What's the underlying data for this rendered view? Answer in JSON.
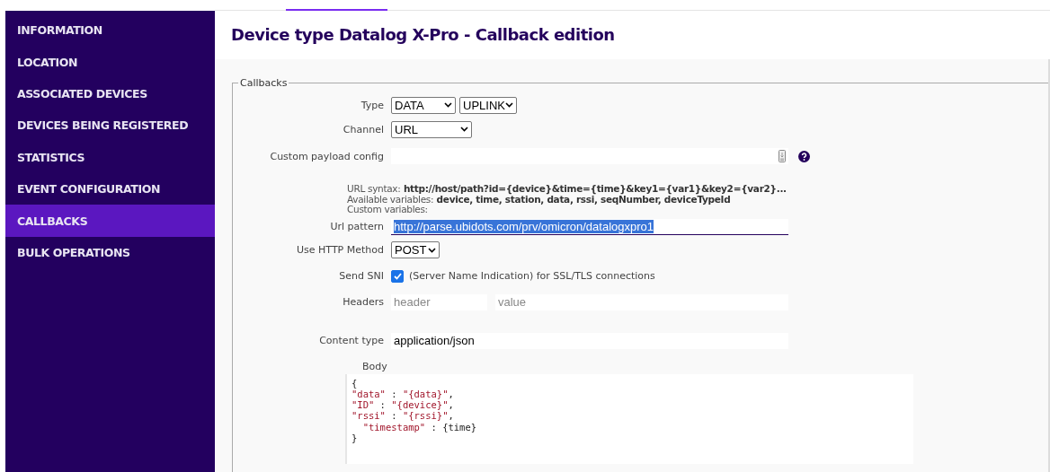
{
  "sidebar": {
    "items": [
      {
        "label": "INFORMATION",
        "selected": false
      },
      {
        "label": "LOCATION",
        "selected": false
      },
      {
        "label": "ASSOCIATED DEVICES",
        "selected": false
      },
      {
        "label": "DEVICES BEING REGISTERED",
        "selected": false
      },
      {
        "label": "STATISTICS",
        "selected": false
      },
      {
        "label": "EVENT CONFIGURATION",
        "selected": false
      },
      {
        "label": "CALLBACKS",
        "selected": true
      },
      {
        "label": "BULK OPERATIONS",
        "selected": false
      }
    ]
  },
  "title": "Device type Datalog X-Pro - Callback edition",
  "fieldset": {
    "legend": "Callbacks",
    "type": {
      "label": "Type",
      "selects": [
        "DATA",
        "UPLINK"
      ]
    },
    "channel": {
      "label": "Channel",
      "select": "URL"
    },
    "custom_payload": {
      "label": "Custom payload config"
    },
    "help": [
      {
        "label": "URL syntax:",
        "value": "http://host/path?id={device}&time={time}&key1={var1}&key2={var2}..."
      },
      {
        "label": "Available variables:",
        "value": "device, time, station, data, rssi, seqNumber, deviceTypeId"
      },
      {
        "label": "Custom variables:"
      }
    ],
    "url_pattern": {
      "label": "Url pattern",
      "value": "http://parse.ubidots.com/prv/omicron/datalogxpro1",
      "selected": true
    },
    "http_method": {
      "label": "Use HTTP Method",
      "select": "POST"
    },
    "send_sni": {
      "label": "Send SNI",
      "checked": true,
      "text": "(Server Name Indication) for SSL/TLS connections"
    },
    "headers": {
      "label": "Headers",
      "header_placeholder": "header",
      "value_placeholder": "value"
    },
    "content_type": {
      "label": "Content type",
      "value": "application/json"
    },
    "body": {
      "label": "Body",
      "lines": [
        [
          {
            "text": "{",
            "kind": "plain"
          }
        ],
        [
          {
            "text": "\"data\"",
            "kind": "string"
          },
          {
            "text": " : ",
            "kind": "plain"
          },
          {
            "text": "\"{data}\"",
            "kind": "string"
          },
          {
            "text": ",",
            "kind": "plain"
          }
        ],
        [
          {
            "text": "\"ID\"",
            "kind": "string"
          },
          {
            "text": " : ",
            "kind": "plain"
          },
          {
            "text": "\"{device}\"",
            "kind": "string"
          },
          {
            "text": ",",
            "kind": "plain"
          }
        ],
        [
          {
            "text": "\"rssi\"",
            "kind": "string"
          },
          {
            "text": " : ",
            "kind": "plain"
          },
          {
            "text": "\"{rssi}\"",
            "kind": "string"
          },
          {
            "text": ",",
            "kind": "plain"
          }
        ],
        [
          {
            "text": "  \"timestamp\"",
            "kind": "string"
          },
          {
            "text": " : {time}",
            "kind": "plain"
          }
        ],
        [
          {
            "text": "}",
            "kind": "plain"
          }
        ]
      ]
    }
  }
}
